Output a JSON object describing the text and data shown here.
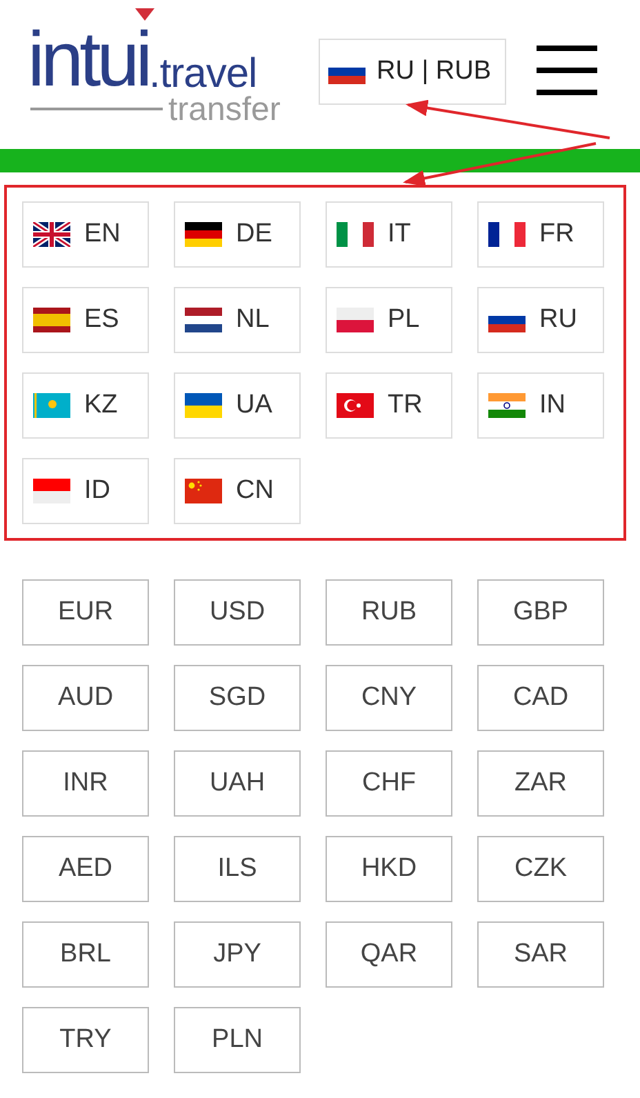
{
  "logo": {
    "brand": "intui",
    "domain": ".travel",
    "product": "transfer"
  },
  "language_button": {
    "label": "RU | RUB"
  },
  "languages": [
    {
      "code": "EN"
    },
    {
      "code": "DE"
    },
    {
      "code": "IT"
    },
    {
      "code": "FR"
    },
    {
      "code": "ES"
    },
    {
      "code": "NL"
    },
    {
      "code": "PL"
    },
    {
      "code": "RU"
    },
    {
      "code": "KZ"
    },
    {
      "code": "UA"
    },
    {
      "code": "TR"
    },
    {
      "code": "IN"
    },
    {
      "code": "ID"
    },
    {
      "code": "CN"
    }
  ],
  "currencies": [
    "EUR",
    "USD",
    "RUB",
    "GBP",
    "AUD",
    "SGD",
    "CNY",
    "CAD",
    "INR",
    "UAH",
    "CHF",
    "ZAR",
    "AED",
    "ILS",
    "HKD",
    "CZK",
    "BRL",
    "JPY",
    "QAR",
    "SAR",
    "TRY",
    "PLN"
  ]
}
